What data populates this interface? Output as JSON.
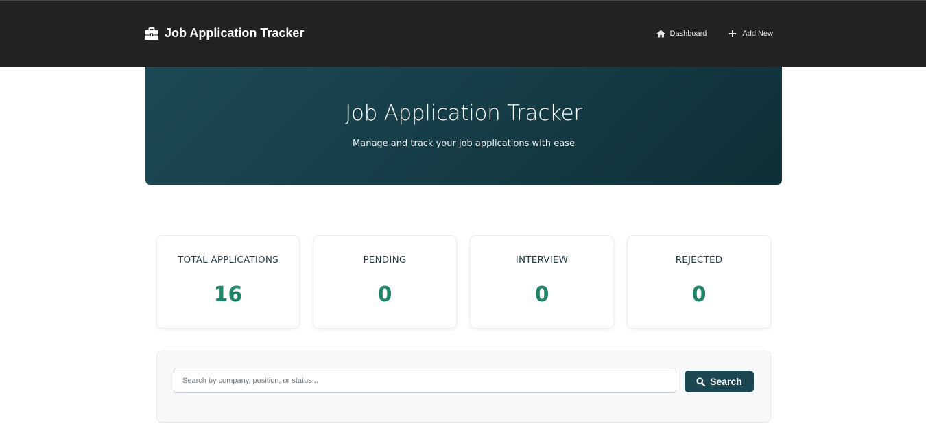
{
  "navbar": {
    "brand_text": "Job Application Tracker",
    "brand_icon": "briefcase-icon",
    "links": [
      {
        "label": "Dashboard",
        "icon": "home-icon"
      },
      {
        "label": "Add New",
        "icon": "plus-icon"
      }
    ]
  },
  "hero": {
    "title": "Job Application Tracker",
    "subtitle": "Manage and track your job applications with ease"
  },
  "stats": [
    {
      "label": "TOTAL APPLICATIONS",
      "value": "16"
    },
    {
      "label": "PENDING",
      "value": "0"
    },
    {
      "label": "INTERVIEW",
      "value": "0"
    },
    {
      "label": "REJECTED",
      "value": "0"
    }
  ],
  "search": {
    "placeholder": "Search by company, position, or status...",
    "value": "",
    "button_label": "Search",
    "button_icon": "search-icon"
  },
  "colors": {
    "navbar_bg": "#222222",
    "hero_gradient_start": "#1c4955",
    "hero_gradient_end": "#0f2f36",
    "stat_value": "#1f8468",
    "stat_label": "#1f3a45",
    "button_bg": "#1b4753"
  }
}
